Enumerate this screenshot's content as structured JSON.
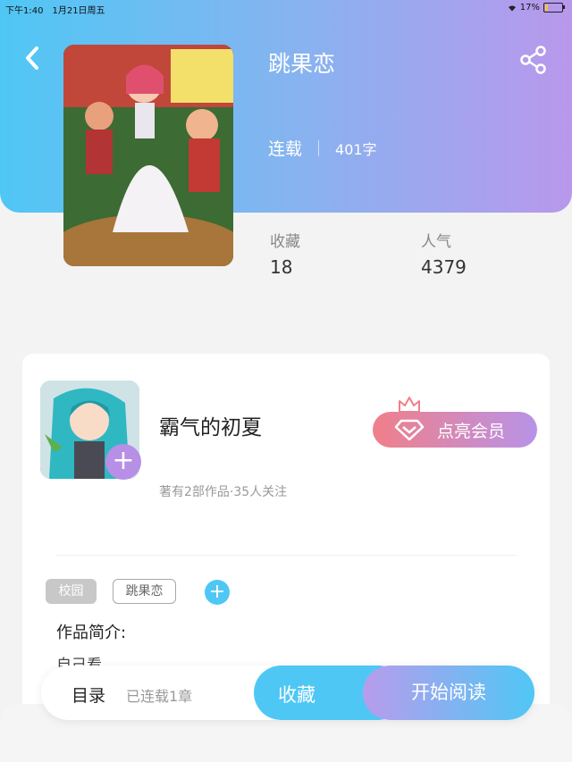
{
  "status_bar": {
    "time": "下午1:40",
    "date": "1月21日周五",
    "battery": "17%",
    "battery_level": 0.17
  },
  "book": {
    "title": "跳果恋",
    "status": "连载",
    "word_count": "401字"
  },
  "stats": [
    {
      "label": "收藏",
      "value": "18"
    },
    {
      "label": "人气",
      "value": "4379"
    }
  ],
  "author": {
    "name": "霸气的初夏",
    "meta": "著有2部作品·35人关注",
    "follow_symbol": "+"
  },
  "vip": {
    "label": "点亮会员"
  },
  "tags": [
    "校园",
    "跳果恋"
  ],
  "add_tag_symbol": "+",
  "intro": {
    "label": "作品简介:",
    "text": "自己看"
  },
  "bottom": {
    "toc_label": "目录",
    "chapters": "已连载1章",
    "favorite": "收藏",
    "read": "开始阅读"
  },
  "icons": {
    "back": "chevron-left-icon",
    "share": "share-icon",
    "crown": "crown-icon",
    "diamond": "diamond-icon"
  },
  "colors": {
    "accent_blue": "#4fc7f5",
    "accent_purple": "#b998ec",
    "vip_pink": "#f07f89"
  }
}
